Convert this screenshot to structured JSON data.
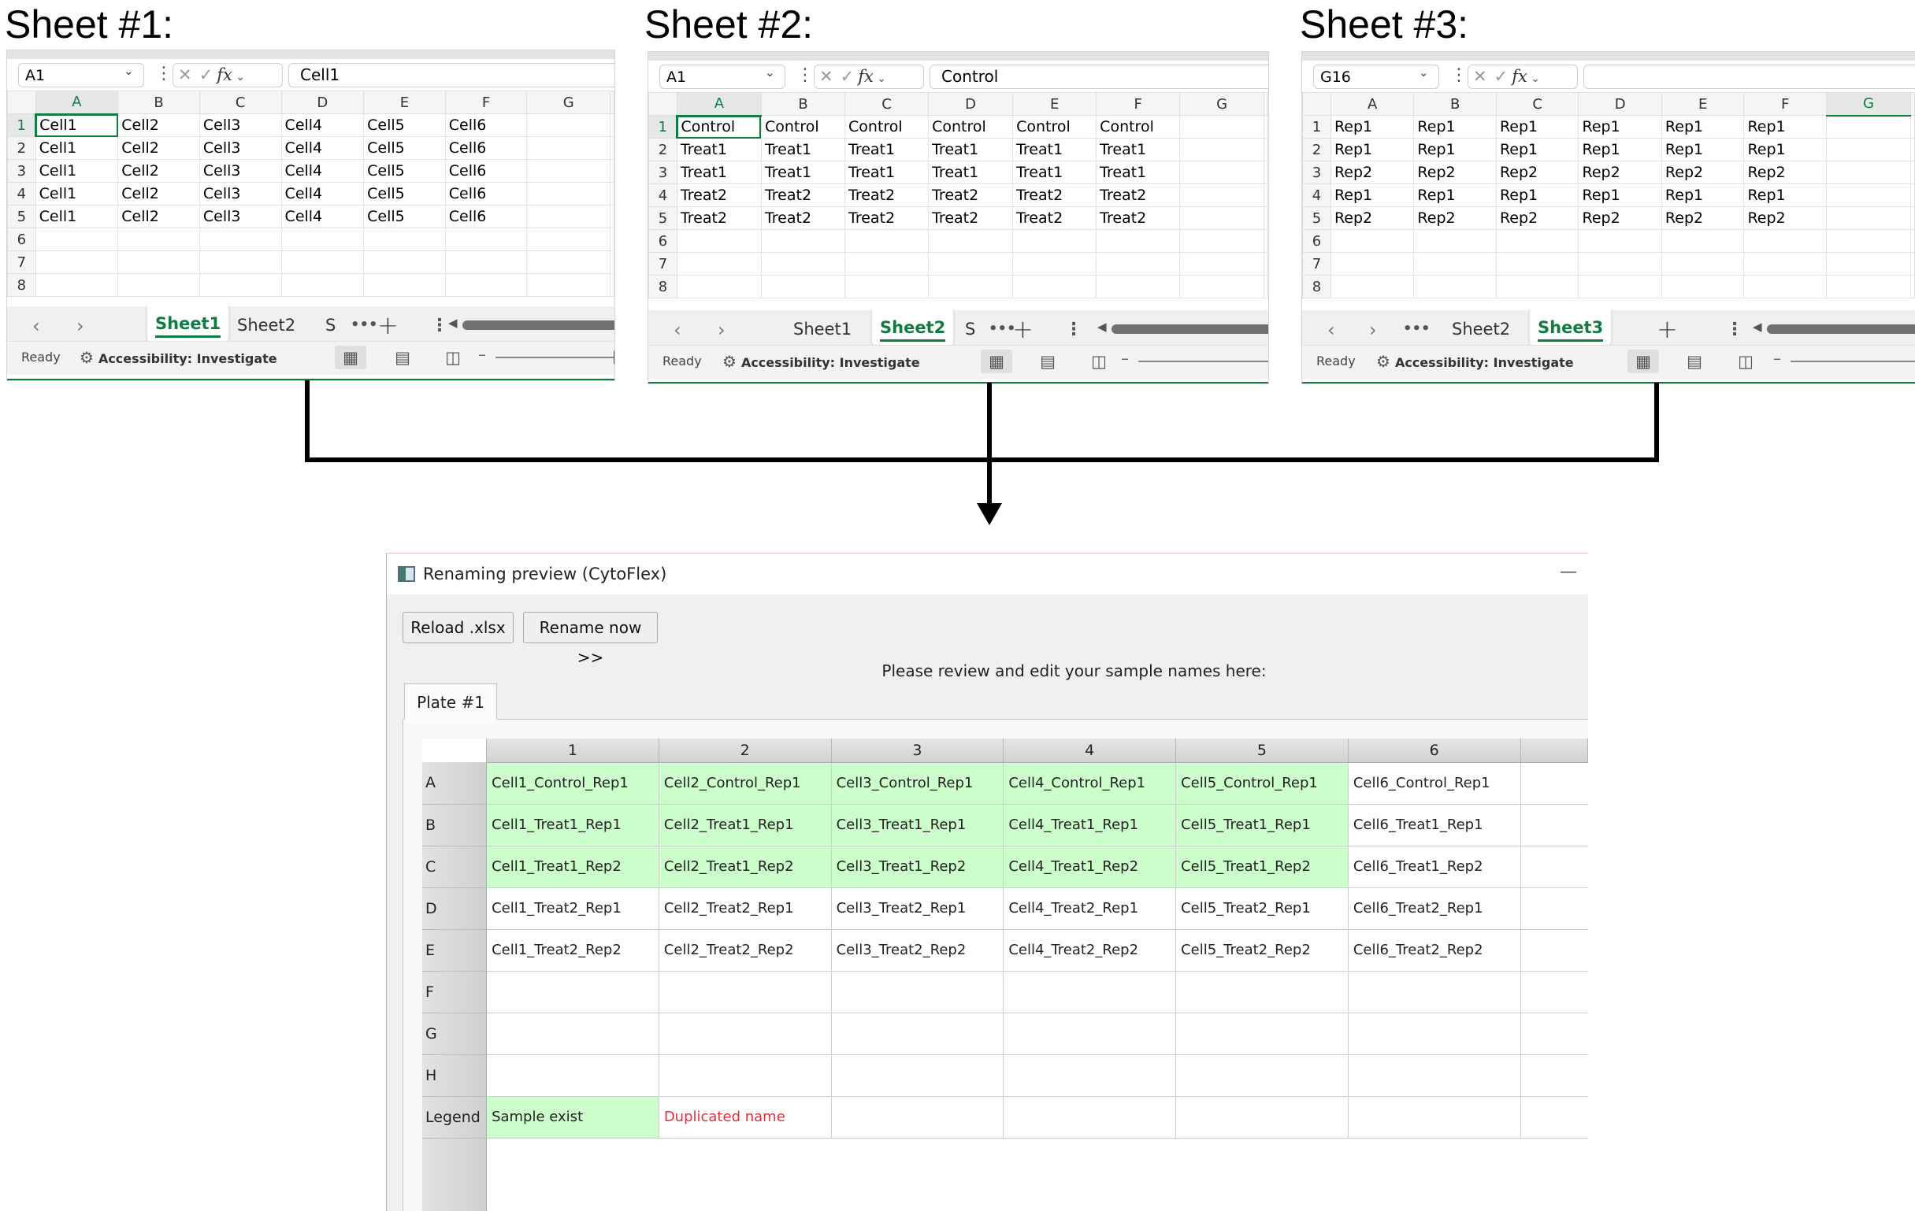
{
  "headings": [
    "Sheet #1:",
    "Sheet #2:",
    "Sheet #3:"
  ],
  "columns": [
    "A",
    "B",
    "C",
    "D",
    "E",
    "F",
    "G"
  ],
  "row_numbers": [
    "1",
    "2",
    "3",
    "4",
    "5",
    "6",
    "7",
    "8"
  ],
  "sheets": [
    {
      "name_box": "A1",
      "formula": "Cell1",
      "selected_col": 0,
      "selected_row": 0,
      "rows": [
        [
          "Cell1",
          "Cell2",
          "Cell3",
          "Cell4",
          "Cell5",
          "Cell6",
          ""
        ],
        [
          "Cell1",
          "Cell2",
          "Cell3",
          "Cell4",
          "Cell5",
          "Cell6",
          ""
        ],
        [
          "Cell1",
          "Cell2",
          "Cell3",
          "Cell4",
          "Cell5",
          "Cell6",
          ""
        ],
        [
          "Cell1",
          "Cell2",
          "Cell3",
          "Cell4",
          "Cell5",
          "Cell6",
          ""
        ],
        [
          "Cell1",
          "Cell2",
          "Cell3",
          "Cell4",
          "Cell5",
          "Cell6",
          ""
        ],
        [
          "",
          "",
          "",
          "",
          "",
          "",
          ""
        ],
        [
          "",
          "",
          "",
          "",
          "",
          "",
          ""
        ],
        [
          "",
          "",
          "",
          "",
          "",
          "",
          ""
        ]
      ],
      "tabs": [
        {
          "label": "Sheet1",
          "active": true
        },
        {
          "label": "Sheet2",
          "active": false
        },
        {
          "label": "S",
          "active": false
        }
      ]
    },
    {
      "name_box": "A1",
      "formula": "Control",
      "selected_col": 0,
      "selected_row": 0,
      "rows": [
        [
          "Control",
          "Control",
          "Control",
          "Control",
          "Control",
          "Control",
          ""
        ],
        [
          "Treat1",
          "Treat1",
          "Treat1",
          "Treat1",
          "Treat1",
          "Treat1",
          ""
        ],
        [
          "Treat1",
          "Treat1",
          "Treat1",
          "Treat1",
          "Treat1",
          "Treat1",
          ""
        ],
        [
          "Treat2",
          "Treat2",
          "Treat2",
          "Treat2",
          "Treat2",
          "Treat2",
          ""
        ],
        [
          "Treat2",
          "Treat2",
          "Treat2",
          "Treat2",
          "Treat2",
          "Treat2",
          ""
        ],
        [
          "",
          "",
          "",
          "",
          "",
          "",
          ""
        ],
        [
          "",
          "",
          "",
          "",
          "",
          "",
          ""
        ],
        [
          "",
          "",
          "",
          "",
          "",
          "",
          ""
        ]
      ],
      "tabs": [
        {
          "label": "Sheet1",
          "active": false
        },
        {
          "label": "Sheet2",
          "active": true
        },
        {
          "label": "S",
          "active": false
        }
      ]
    },
    {
      "name_box": "G16",
      "formula": "",
      "selected_col": 6,
      "selected_row": -1,
      "rows": [
        [
          "Rep1",
          "Rep1",
          "Rep1",
          "Rep1",
          "Rep1",
          "Rep1",
          ""
        ],
        [
          "Rep1",
          "Rep1",
          "Rep1",
          "Rep1",
          "Rep1",
          "Rep1",
          ""
        ],
        [
          "Rep2",
          "Rep2",
          "Rep2",
          "Rep2",
          "Rep2",
          "Rep2",
          ""
        ],
        [
          "Rep1",
          "Rep1",
          "Rep1",
          "Rep1",
          "Rep1",
          "Rep1",
          ""
        ],
        [
          "Rep2",
          "Rep2",
          "Rep2",
          "Rep2",
          "Rep2",
          "Rep2",
          ""
        ],
        [
          "",
          "",
          "",
          "",
          "",
          "",
          ""
        ],
        [
          "",
          "",
          "",
          "",
          "",
          "",
          ""
        ],
        [
          "",
          "",
          "",
          "",
          "",
          "",
          ""
        ]
      ],
      "tabs": [
        {
          "label": "Sheet2",
          "active": false
        },
        {
          "label": "Sheet3",
          "active": true
        }
      ]
    }
  ],
  "status": {
    "ready": "Ready",
    "accessibility": "Accessibility: Investigate"
  },
  "icons": {
    "nav_prev": "chevron-left-icon",
    "nav_next": "chevron-right-icon",
    "more": "more-horizontal-icon",
    "add_sheet": "plus-icon",
    "options": "more-vertical-icon",
    "cancel": "cancel-x-icon",
    "enter": "check-icon",
    "function": "fx-icon",
    "normal_view": "grid-view-icon",
    "page_layout": "page-layout-icon",
    "page_break": "page-break-icon",
    "zoom_out": "minus-icon",
    "accessibility": "accessibility-icon",
    "window": "window-icon",
    "minimize": "minimize-icon"
  },
  "dialog": {
    "title": "Renaming preview (CytoFlex)",
    "reload_button": "Reload .xlsx",
    "rename_button": "Rename now >>",
    "instruction": "Please review and edit your sample names here:",
    "tab": "Plate #1",
    "col_headers": [
      "1",
      "2",
      "3",
      "4",
      "5",
      "6"
    ],
    "row_labels": [
      "A",
      "B",
      "C",
      "D",
      "E",
      "F",
      "G",
      "H"
    ],
    "rows": [
      [
        "Cell1_Control_Rep1",
        "Cell2_Control_Rep1",
        "Cell3_Control_Rep1",
        "Cell4_Control_Rep1",
        "Cell5_Control_Rep1",
        "Cell6_Control_Rep1"
      ],
      [
        "Cell1_Treat1_Rep1",
        "Cell2_Treat1_Rep1",
        "Cell3_Treat1_Rep1",
        "Cell4_Treat1_Rep1",
        "Cell5_Treat1_Rep1",
        "Cell6_Treat1_Rep1"
      ],
      [
        "Cell1_Treat1_Rep2",
        "Cell2_Treat1_Rep2",
        "Cell3_Treat1_Rep2",
        "Cell4_Treat1_Rep2",
        "Cell5_Treat1_Rep2",
        "Cell6_Treat1_Rep2"
      ],
      [
        "Cell1_Treat2_Rep1",
        "Cell2_Treat2_Rep1",
        "Cell3_Treat2_Rep1",
        "Cell4_Treat2_Rep1",
        "Cell5_Treat2_Rep1",
        "Cell6_Treat2_Rep1"
      ],
      [
        "Cell1_Treat2_Rep2",
        "Cell2_Treat2_Rep2",
        "Cell3_Treat2_Rep2",
        "Cell4_Treat2_Rep2",
        "Cell5_Treat2_Rep2",
        "Cell6_Treat2_Rep2"
      ],
      [
        "",
        "",
        "",
        "",
        "",
        ""
      ],
      [
        "",
        "",
        "",
        "",
        "",
        ""
      ],
      [
        "",
        "",
        "",
        "",
        "",
        ""
      ]
    ],
    "exists_rows": 3,
    "exists_cols": 5,
    "legend": {
      "label": "Legend",
      "exists": "Sample exist",
      "duplicate": "Duplicated name"
    },
    "colors": {
      "exists": "#ccffcc",
      "duplicate": "#e0303a"
    }
  }
}
